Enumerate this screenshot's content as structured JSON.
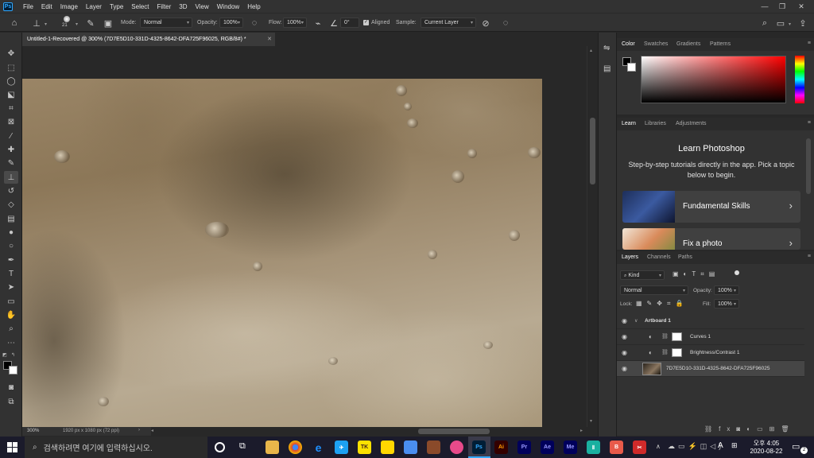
{
  "menubar": {
    "items": [
      "File",
      "Edit",
      "Image",
      "Layer",
      "Type",
      "Select",
      "Filter",
      "3D",
      "View",
      "Window",
      "Help"
    ]
  },
  "options": {
    "brush_size": "21",
    "mode_label": "Mode:",
    "mode_value": "Normal",
    "opacity_label": "Opacity:",
    "opacity_value": "100%",
    "flow_label": "Flow:",
    "flow_value": "100%",
    "angle_value": "0°",
    "aligned_label": "Aligned",
    "sample_label": "Sample:",
    "sample_value": "Current Layer"
  },
  "document": {
    "tab_title": "Untitled-1-Recovered @ 300% (7D7E5D10-331D-4325-8642-DFA725F96025, RGB/8#) *",
    "zoom": "300%",
    "doc_info": "1920 px x 1080 px (72 ppi)"
  },
  "color_panel": {
    "tabs": [
      "Color",
      "Swatches",
      "Gradients",
      "Patterns"
    ]
  },
  "learn_panel": {
    "tabs": [
      "Learn",
      "Libraries",
      "Adjustments"
    ],
    "title": "Learn Photoshop",
    "description": "Step-by-step tutorials directly in the app. Pick a topic below to begin.",
    "cards": [
      "Fundamental Skills",
      "Fix a photo"
    ]
  },
  "layers_panel": {
    "tabs": [
      "Layers",
      "Channels",
      "Paths"
    ],
    "filter_kind": "Kind",
    "blend_mode": "Normal",
    "opacity_label": "Opacity:",
    "opacity_value": "100%",
    "lock_label": "Lock:",
    "fill_label": "Fill:",
    "fill_value": "100%",
    "layers": [
      "Artboard 1",
      "Curves 1",
      "Brightness/Contrast 1",
      "7D7E5D10-331D-4325-8642-DFA725F96025"
    ],
    "footer_fx": "fx"
  },
  "taskbar": {
    "search_placeholder": "검색하려면 여기에 입력하십시오.",
    "apps": [
      "Ps",
      "Ai",
      "Pr",
      "Ae",
      "Me"
    ],
    "time": "오후 4:05",
    "date": "2020-08-22",
    "ime": "A",
    "notification_count": "2"
  },
  "colors": {
    "ps_blue": "#31a8ff",
    "ai_orange": "#ff9a00",
    "pr_purple": "#9999ff",
    "ae_purple": "#9999ff",
    "me_purple": "#9999ff"
  }
}
